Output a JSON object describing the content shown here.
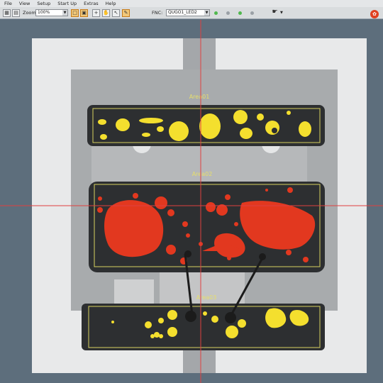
{
  "menu": [
    "File",
    "View",
    "Setup",
    "Start Up",
    "Extras",
    "Help"
  ],
  "toolbar": {
    "zoom_label": "Zoom:",
    "zoom_value": "100%",
    "fnc_label": "FNC:",
    "fnc_value": "QUGO1_LED2"
  },
  "areas": [
    {
      "label": "Area01"
    },
    {
      "label": "Area02"
    },
    {
      "label": "Area03"
    }
  ],
  "colors": {
    "void_small": "#f4df2e",
    "void_large": "#e2381f",
    "crosshair": "#e04040",
    "roi_border": "#d6d260"
  }
}
